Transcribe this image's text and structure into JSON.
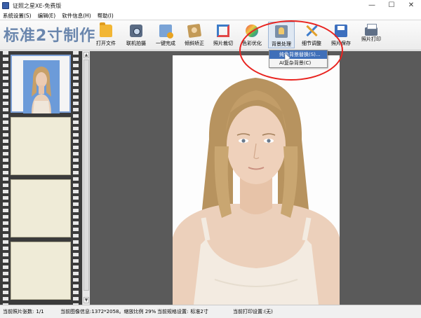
{
  "window": {
    "title": "证照之星XE-免费版",
    "controls": [
      "—",
      "☐",
      "✕"
    ]
  },
  "menu": {
    "items": [
      "系统设置(S)",
      "编辑(E)",
      "软件信息(H)",
      "帮助(I)"
    ]
  },
  "toolbar": {
    "heading": "标准2寸制作",
    "tools": [
      {
        "label": "打开文件",
        "icon": "folder-icon"
      },
      {
        "label": "联机拍摄",
        "icon": "camera-icon"
      },
      {
        "label": "一键完成",
        "icon": "one-click-icon"
      },
      {
        "label": "倾斜矫正",
        "icon": "tilt-correct-icon"
      },
      {
        "label": "照片裁切",
        "icon": "crop-icon"
      },
      {
        "label": "色彩优化",
        "icon": "color-wheel-icon"
      },
      {
        "label": "背景处理",
        "icon": "background-icon"
      },
      {
        "label": "细节调整",
        "icon": "tools-icon"
      },
      {
        "label": "照片保存",
        "icon": "save-icon"
      },
      {
        "label": "照片打印",
        "icon": "printer-icon"
      }
    ]
  },
  "background_menu": {
    "items": [
      "纯色背景替换(S)...",
      "AI复杂背景(C)"
    ]
  },
  "annotation_color": "#e8231f",
  "statusbar": {
    "photo_count_label": "当前照片张数:",
    "photo_count_value": "1/1",
    "image_info_label": "当前图像信息:",
    "image_info_value": "1372*2058。缩放比例 29%",
    "spec_label": "当前规格设置:",
    "spec_value": "标准2寸",
    "print_label": "当前打印设置:",
    "print_value": "(无)"
  }
}
